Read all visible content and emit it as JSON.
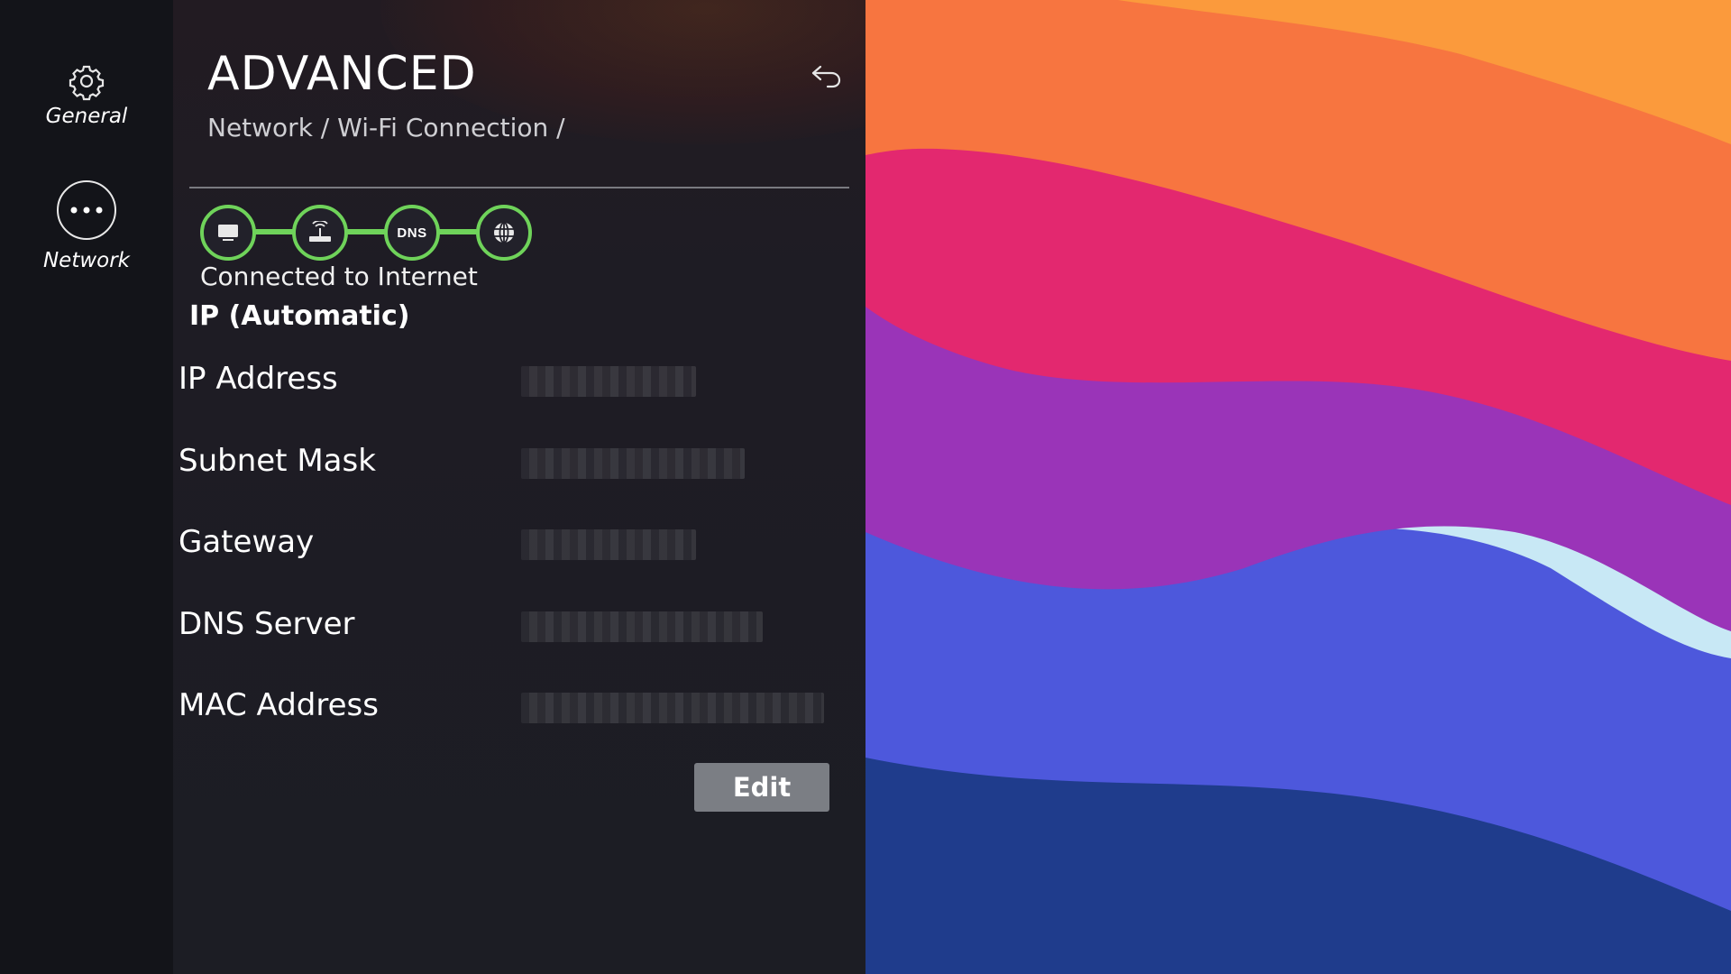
{
  "nav": {
    "items": [
      {
        "label": "General",
        "icon": "gear-icon"
      },
      {
        "label": "Network",
        "icon": "more-dots-icon",
        "selected": true
      }
    ]
  },
  "panel": {
    "title": "ADVANCED",
    "breadcrumb": "Network / Wi-Fi Connection /",
    "back_icon": "back-arrow-icon",
    "chain": {
      "nodes": [
        "tv-icon",
        "router-icon",
        "DNS",
        "globe-icon"
      ],
      "status": "Connected to Internet",
      "color": "#6fd35a"
    },
    "section_title": "IP (Automatic)",
    "rows": [
      {
        "label": "IP Address",
        "value": "redacted"
      },
      {
        "label": "Subnet Mask",
        "value": "redacted"
      },
      {
        "label": "Gateway",
        "value": "redacted"
      },
      {
        "label": "DNS Server",
        "value": "redacted"
      },
      {
        "label": "MAC Address",
        "value": "redacted"
      }
    ],
    "edit_label": "Edit"
  },
  "colors": {
    "accent": "#6fd35a",
    "edit_button": "#7b7e84",
    "nav_bg": "#131419",
    "panel_bg": "#1c1d24"
  }
}
